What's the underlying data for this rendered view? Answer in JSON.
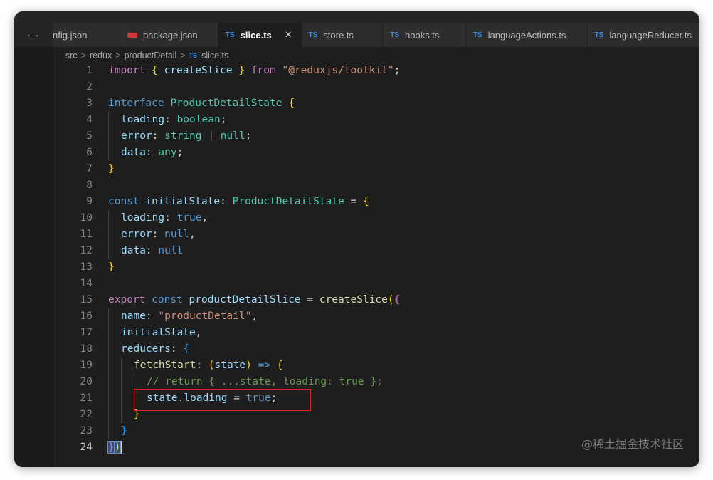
{
  "tabs": [
    {
      "label": "nfig.json",
      "icon": "json-icon",
      "active": false
    },
    {
      "label": "package.json",
      "icon": "npm-icon",
      "active": false
    },
    {
      "label": "slice.ts",
      "icon": "ts-icon",
      "active": true
    },
    {
      "label": "store.ts",
      "icon": "ts-icon",
      "active": false
    },
    {
      "label": "hooks.ts",
      "icon": "ts-icon",
      "active": false
    },
    {
      "label": "languageActions.ts",
      "icon": "ts-icon",
      "active": false
    },
    {
      "label": "languageReducer.ts",
      "icon": "ts-icon",
      "active": false
    }
  ],
  "tab_more": "···",
  "ts_badge": "TS",
  "close_glyph": "✕",
  "breadcrumb": {
    "items": [
      "src",
      "redux",
      "productDetail"
    ],
    "file": "slice.ts",
    "separator": ">"
  },
  "line_numbers": [
    "1",
    "2",
    "3",
    "4",
    "5",
    "6",
    "7",
    "8",
    "9",
    "10",
    "11",
    "12",
    "13",
    "14",
    "15",
    "16",
    "17",
    "18",
    "19",
    "20",
    "21",
    "22",
    "23",
    "24"
  ],
  "current_line": "24",
  "code": {
    "l1": [
      "import",
      " ",
      "{",
      " createSlice ",
      "}",
      " from ",
      "\"@reduxjs/toolkit\"",
      ";"
    ],
    "l3": [
      "interface",
      " ",
      "ProductDetailState",
      " ",
      "{"
    ],
    "l4": [
      "loading",
      ": ",
      "boolean",
      ";"
    ],
    "l5": [
      "error",
      ": ",
      "string",
      " | ",
      "null",
      ";"
    ],
    "l6": [
      "data",
      ": ",
      "any",
      ";"
    ],
    "l7": [
      "}"
    ],
    "l9": [
      "const",
      " ",
      "initialState",
      ": ",
      "ProductDetailState",
      " = ",
      "{"
    ],
    "l10": [
      "loading",
      ": ",
      "true",
      ","
    ],
    "l11": [
      "error",
      ": ",
      "null",
      ","
    ],
    "l12": [
      "data",
      ": ",
      "null"
    ],
    "l13": [
      "}"
    ],
    "l15": [
      "export",
      " ",
      "const",
      " ",
      "productDetailSlice",
      " = ",
      "createSlice",
      "(",
      "{"
    ],
    "l16": [
      "name",
      ": ",
      "\"productDetail\"",
      ","
    ],
    "l17": [
      "initialState",
      ","
    ],
    "l18": [
      "reducers",
      ": ",
      "{"
    ],
    "l19": [
      "fetchStart",
      ": ",
      "(",
      "state",
      ")",
      " => ",
      "{"
    ],
    "l20": [
      "// return { ...state, loading: true };"
    ],
    "l21": [
      "state",
      ".",
      "loading",
      " = ",
      "true",
      ";"
    ],
    "l22": [
      "}"
    ],
    "l23": [
      "}"
    ],
    "l24": [
      "}",
      ")"
    ]
  },
  "watermark": "@稀土掘金技术社区",
  "colors": {
    "editor_bg": "#1e1e1e",
    "keyword": "#569cd6",
    "control_keyword": "#c586c0",
    "type": "#4ec9b0",
    "variable": "#9cdcfe",
    "function": "#dcdcaa",
    "string": "#ce9178",
    "comment": "#6a9955",
    "highlight_box": "#e02424"
  }
}
